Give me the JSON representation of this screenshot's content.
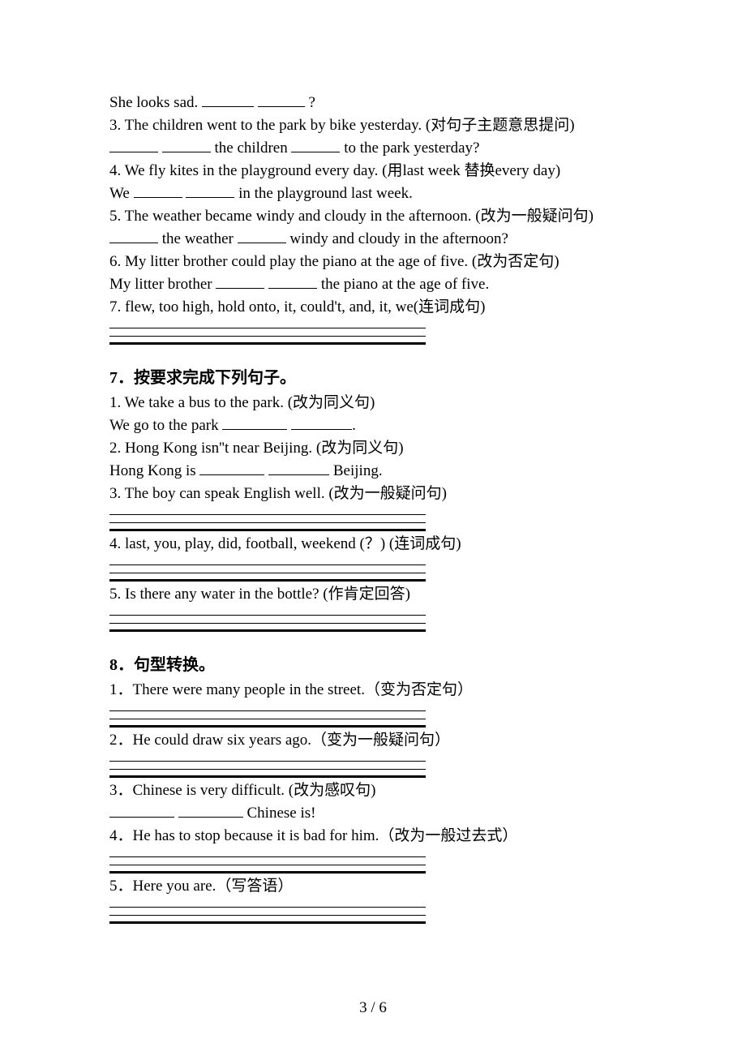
{
  "intro": {
    "l1a": "She looks sad. ",
    "l1b": " ",
    "l1c": " ?",
    "l2": "3. The children went to the park by bike yesterday. (对句子主题意思提问)",
    "l3a": "",
    "l3b": " ",
    "l3c": " the children ",
    "l3d": " to the park yesterday?",
    "l4": "4. We fly kites in the playground every day. (用last week 替换every day)",
    "l5a": "We ",
    "l5b": " ",
    "l5c": " in the playground last week.",
    "l6": "5. The weather became windy and cloudy in the afternoon. (改为一般疑问句)",
    "l7a": "",
    "l7b": " the weather ",
    "l7c": " windy and cloudy in the afternoon?",
    "l8": "6. My litter brother could play the piano at the age of five. (改为否定句)",
    "l9a": "My litter brother ",
    "l9b": " ",
    "l9c": " the piano at the age of five.",
    "l10": "7. flew, too high, hold onto, it, could't, and, it, we(连词成句)"
  },
  "s7": {
    "head": "7．按要求完成下列句子。",
    "q1": "1. We take a bus to the park. (改为同义句)",
    "q1a_a": "We go to the park ",
    "q1a_b": " ",
    "q1a_c": ".",
    "q2": "2. Hong Kong isn''t near Beijing. (改为同义句)",
    "q2a_a": "Hong Kong is ",
    "q2a_b": " ",
    "q2a_c": " Beijing.",
    "q3": "3. The boy can speak English well. (改为一般疑问句)",
    "q4": "4. last, you, play, did, football, weekend (？) (连词成句)",
    "q5": "5. Is there any water in the bottle? (作肯定回答)"
  },
  "s8": {
    "head": "8．句型转换。",
    "q1": "1．There were many people in the street.（变为否定句）",
    "q2": "2．He could draw six years ago.（变为一般疑问句）",
    "q3": "3．Chinese is very difficult. (改为感叹句)",
    "q3a_a": "",
    "q3a_b": " ",
    "q3a_c": " Chinese is!",
    "q4": "4．He has to stop because it is bad for him.（改为一般过去式）",
    "q5": "5．Here you are.（写答语）"
  },
  "footer": "3 / 6"
}
